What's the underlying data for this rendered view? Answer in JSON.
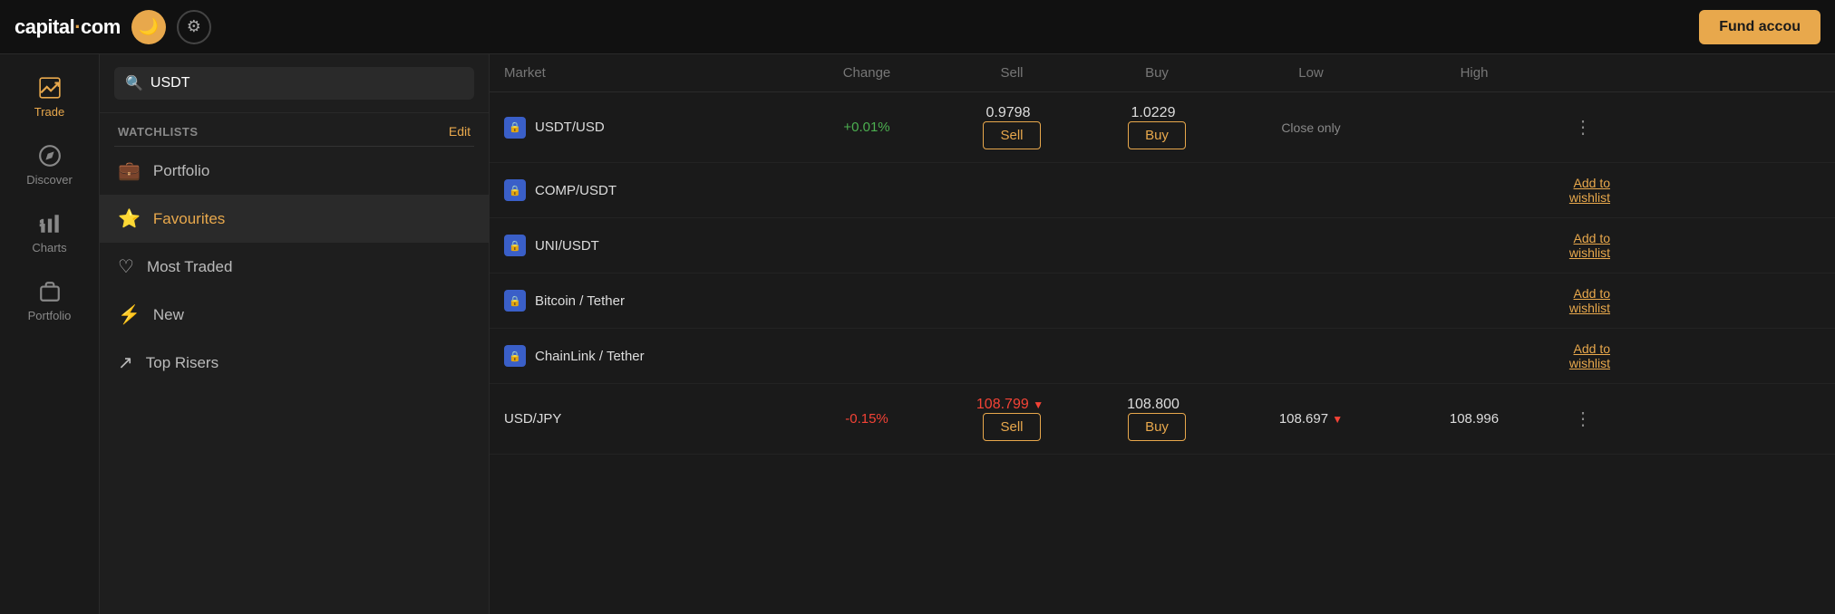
{
  "app": {
    "logo": "capital·com",
    "fund_button": "Fund accou..."
  },
  "topbar": {
    "logo_main": "capital",
    "logo_dot": "·",
    "logo_com": "com",
    "moon_icon": "🌙",
    "gear_icon": "⚙",
    "fund_label": "Fund accou"
  },
  "sidebar": {
    "items": [
      {
        "id": "trade",
        "label": "Trade",
        "active": true
      },
      {
        "id": "discover",
        "label": "Discover",
        "active": false
      },
      {
        "id": "charts",
        "label": "Charts",
        "active": false
      },
      {
        "id": "portfolio",
        "label": "Portfolio",
        "active": false
      }
    ]
  },
  "watchlist": {
    "search_placeholder": "USDT",
    "search_value": "USDT",
    "header_label": "WATCHLISTS",
    "edit_label": "Edit",
    "items": [
      {
        "id": "portfolio",
        "label": "Portfolio",
        "icon": "💼",
        "active": false
      },
      {
        "id": "favourites",
        "label": "Favourites",
        "icon": "⭐",
        "active": true
      },
      {
        "id": "most-traded",
        "label": "Most Traded",
        "icon": "♡",
        "active": false
      },
      {
        "id": "new",
        "label": "New",
        "icon": "⚡",
        "active": false
      },
      {
        "id": "top-risers",
        "label": "Top Risers",
        "icon": "↗",
        "active": false
      }
    ]
  },
  "table": {
    "headers": [
      "Market",
      "Change",
      "Sell",
      "Buy",
      "Low",
      "High",
      ""
    ],
    "rows": [
      {
        "market": "USDT/USD",
        "badge": "🔒",
        "change": "+0.01%",
        "change_type": "positive",
        "sell_price": "0.9798",
        "sell_label": "Sell",
        "buy_price": "1.0229",
        "buy_label": "Buy",
        "low": "Close only",
        "low_type": "close",
        "high": "",
        "action": "dots",
        "wishlist": ""
      },
      {
        "market": "COMP/USDT",
        "badge": "🔒",
        "change": "",
        "change_type": "none",
        "sell_price": "",
        "sell_label": "",
        "buy_price": "",
        "buy_label": "",
        "low": "",
        "high": "",
        "action": "",
        "wishlist": "Add to wishlist"
      },
      {
        "market": "UNI/USDT",
        "badge": "🔒",
        "change": "",
        "change_type": "none",
        "sell_price": "",
        "sell_label": "",
        "buy_price": "",
        "buy_label": "",
        "low": "",
        "high": "",
        "action": "",
        "wishlist": "Add to wishlist"
      },
      {
        "market": "Bitcoin / Tether",
        "badge": "🔒",
        "change": "",
        "change_type": "none",
        "sell_price": "",
        "sell_label": "",
        "buy_price": "",
        "buy_label": "",
        "low": "",
        "high": "",
        "action": "",
        "wishlist": "Add to wishlist"
      },
      {
        "market": "ChainLink / Tether",
        "badge": "🔒",
        "change": "",
        "change_type": "none",
        "sell_price": "",
        "sell_label": "",
        "buy_price": "",
        "buy_label": "",
        "low": "",
        "high": "",
        "action": "",
        "wishlist": "Add to wishlist"
      },
      {
        "market": "USD/JPY",
        "badge": "",
        "change": "-0.15%",
        "change_type": "negative",
        "sell_price": "108.799",
        "sell_arrow": "▼",
        "sell_label": "Sell",
        "buy_price": "108.800",
        "buy_label": "Buy",
        "low": "108.697",
        "low_arrow": "▼",
        "high": "108.996",
        "action": "dots",
        "wishlist": ""
      }
    ]
  }
}
